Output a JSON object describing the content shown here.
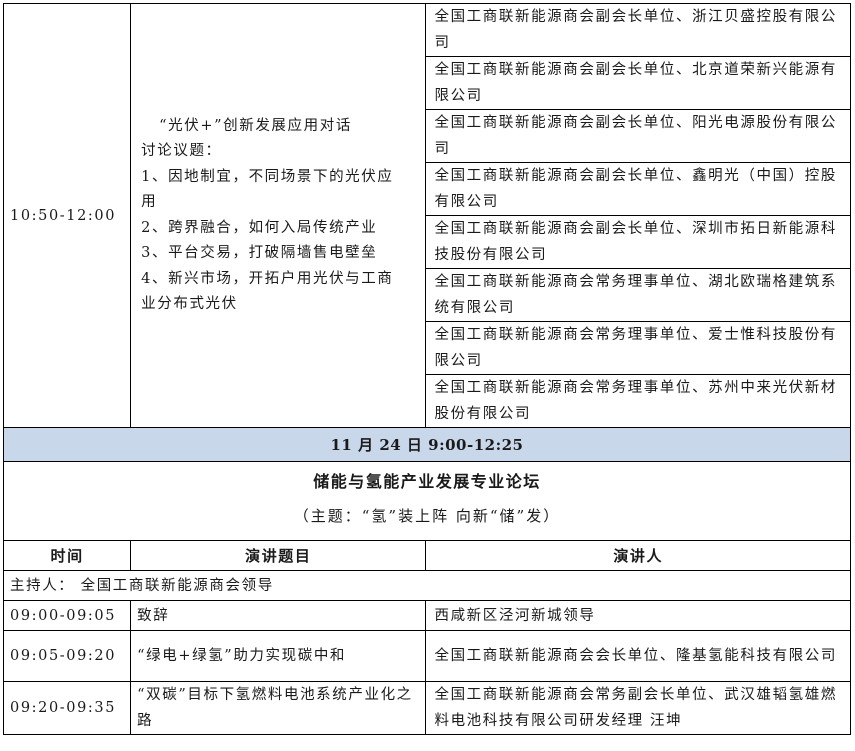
{
  "dialogue": {
    "time": "10:50-12:00",
    "topic_lines": [
      "“光伏+”创新发展应用对话",
      "讨论议题：",
      "1、因地制宜，不同场景下的光伏应",
      "用",
      "2、跨界融合，如何入局传统产业",
      "3、平台交易，打破隔墙售电壁垒",
      "4、新兴市场，开拓户用光伏与工商",
      "业分布式光伏"
    ],
    "speakers": [
      "全国工商联新能源商会副会长单位、浙江贝盛控股有限公司",
      "全国工商联新能源商会副会长单位、北京道荣新兴能源有限公司",
      "全国工商联新能源商会副会长单位、阳光电源股份有限公司",
      "全国工商联新能源商会副会长单位、鑫明光（中国）控股有限公司",
      "全国工商联新能源商会副会长单位、深圳市拓日新能源科技股份有限公司",
      "全国工商联新能源商会常务理事单位、湖北欧瑞格建筑系统有限公司",
      "全国工商联新能源商会常务理事单位、爱士惟科技股份有限公司",
      "全国工商联新能源商会常务理事单位、苏州中来光伏新材股份有限公司"
    ]
  },
  "date_bar": "11 月 24 日 9:00-12:25",
  "forum": {
    "title": "储能与氢能产业发展专业论坛",
    "subtitle": "（主题：“氢”装上阵 向新“储”发）"
  },
  "headers": {
    "time": "时间",
    "topic": "演讲题目",
    "speaker": "演讲人"
  },
  "host": "主持人： 全国工商联新能源商会领导",
  "rows": [
    {
      "time": "09:00-09:05",
      "topic": "致辞",
      "speaker": "西咸新区泾河新城领导"
    },
    {
      "time": "09:05-09:20",
      "topic": "“绿电+绿氢”助力实现碳中和",
      "speaker": "全国工商联新能源商会会长单位、隆基氢能科技有限公司"
    },
    {
      "time": "09:20-09:35",
      "topic": "“双碳”目标下氢燃料电池系统产业化之路",
      "speaker": "全国工商联新能源商会常务副会长单位、武汉雄韬氢雄燃料电池科技有限公司研发经理 汪坤"
    }
  ]
}
